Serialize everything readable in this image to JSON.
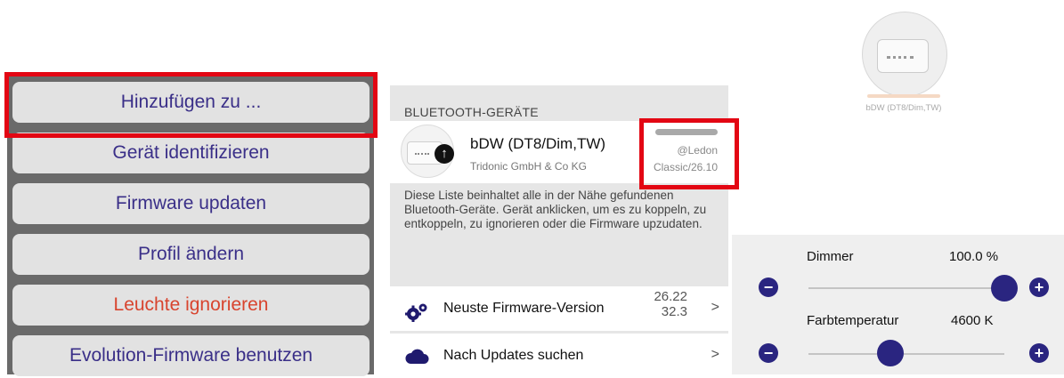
{
  "context_menu": {
    "items": [
      {
        "label": "Hinzufügen zu ..."
      },
      {
        "label": "Gerät identifizieren"
      },
      {
        "label": "Firmware updaten"
      },
      {
        "label": "Profil ändern"
      },
      {
        "label": "Leuchte ignorieren"
      },
      {
        "label": "Evolution-Firmware benutzen"
      }
    ]
  },
  "bluetooth": {
    "header": "BLUETOOTH-GERÄTE",
    "device": {
      "name": "bDW (DT8/Dim,TW)",
      "vendor": "Tridonic GmbH & Co KG",
      "tag": "@Ledon",
      "firmware": "Classic/26.10",
      "icon": "upload-arrow-icon"
    },
    "description": "Diese Liste beinhaltet alle in der Nähe gefundenen Bluetooth-Geräte. Gerät anklicken, um es zu koppeln, zu entkoppeln, zu ignorieren oder die Firmware upzudaten.",
    "rows": [
      {
        "label": "Neuste Firmware-Version",
        "version_line1": "26.22",
        "version_line2": "32.3",
        "icon": "gears-icon"
      },
      {
        "label": "Nach Updates suchen",
        "icon": "cloud-icon"
      }
    ],
    "chevron": ">"
  },
  "product": {
    "name": "bDW (DT8/Dim,TW)"
  },
  "sliders": {
    "dimmer": {
      "label": "Dimmer",
      "value_text": "100.0 %",
      "level": 1.0
    },
    "color_temp": {
      "label": "Farbtemperatur",
      "value_text": "4600 K",
      "level": 0.42
    },
    "minus_symbol": "−",
    "plus_symbol": "+"
  },
  "colors": {
    "highlight": "#e30613",
    "accent": "#2a2580",
    "danger": "#d8442e",
    "menu_text": "#3a2f88"
  }
}
